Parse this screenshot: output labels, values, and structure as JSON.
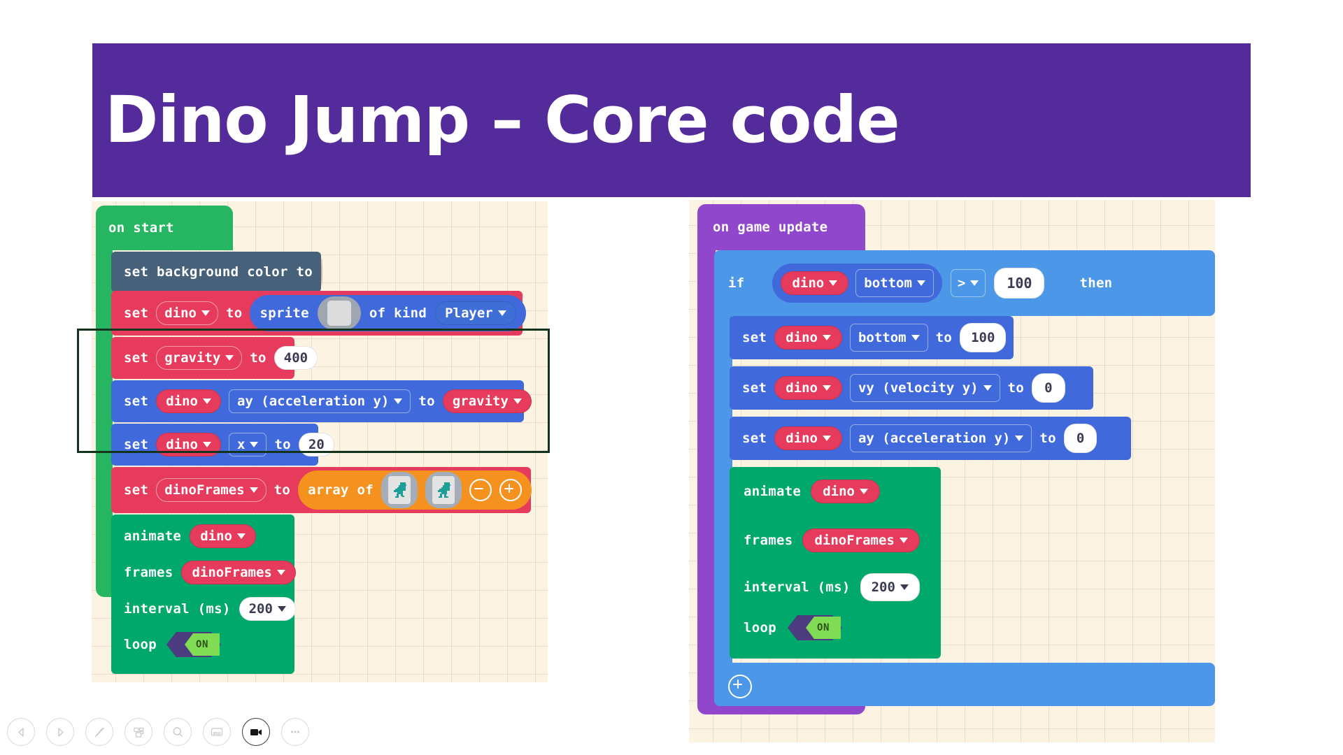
{
  "slide": {
    "title": "Dino Jump – Core code",
    "banner_color": "#542B9A",
    "canvas_bg": "#FCF3E3"
  },
  "left_program": {
    "event": {
      "label": "on start",
      "color": "#26B561"
    },
    "background_color_block": {
      "label": "set background color to",
      "color": "#47617A",
      "swatch_color": "#E8CABB"
    },
    "set_sprite": {
      "set": "set",
      "variable": "dino",
      "to": "to",
      "sprite_label": "sprite",
      "of_kind": "of kind",
      "kind": "Player"
    },
    "set_gravity": {
      "set": "set",
      "variable": "gravity",
      "to": "to",
      "value": "400"
    },
    "set_ay": {
      "set": "set",
      "variable": "dino",
      "property": "ay (acceleration y)",
      "to": "to",
      "value": "gravity"
    },
    "set_x": {
      "set": "set",
      "variable": "dino",
      "property": "x",
      "to": "to",
      "value": "20"
    },
    "set_frames": {
      "set": "set",
      "variable": "dinoFrames",
      "to": "to",
      "array_label": "array of",
      "frames_count": 2,
      "minus_icon": "minus-circle-icon",
      "plus_icon": "plus-circle-icon"
    },
    "animate": {
      "animate_label": "animate",
      "target": "dino",
      "frames_label": "frames",
      "frames_value": "dinoFrames",
      "interval_label": "interval (ms)",
      "interval_value": "200",
      "loop_label": "loop",
      "loop_state": "ON"
    }
  },
  "right_program": {
    "event": {
      "label": "on game update",
      "color": "#9147CC"
    },
    "if_block": {
      "if": "if",
      "variable": "dino",
      "property": "bottom",
      "operator": ">",
      "compare_value": "100",
      "then": "then",
      "add_icon": "plus-circle-icon"
    },
    "set_bottom": {
      "set": "set",
      "variable": "dino",
      "property": "bottom",
      "to": "to",
      "value": "100"
    },
    "set_vy": {
      "set": "set",
      "variable": "dino",
      "property": "vy (velocity y)",
      "to": "to",
      "value": "0"
    },
    "set_ay": {
      "set": "set",
      "variable": "dino",
      "property": "ay (acceleration y)",
      "to": "to",
      "value": "0"
    },
    "animate": {
      "animate_label": "animate",
      "target": "dino",
      "frames_label": "frames",
      "frames_value": "dinoFrames",
      "interval_label": "interval (ms)",
      "interval_value": "200",
      "loop_label": "loop",
      "loop_state": "ON"
    }
  },
  "toolbar": {
    "buttons": [
      {
        "name": "previous-slide-icon",
        "active": false
      },
      {
        "name": "next-slide-icon",
        "active": false
      },
      {
        "name": "pen-icon",
        "active": false
      },
      {
        "name": "slide-grid-icon",
        "active": false
      },
      {
        "name": "zoom-icon",
        "active": false
      },
      {
        "name": "captions-icon",
        "active": false
      },
      {
        "name": "video-camera-icon",
        "active": true
      },
      {
        "name": "more-options-icon",
        "active": false
      }
    ]
  }
}
